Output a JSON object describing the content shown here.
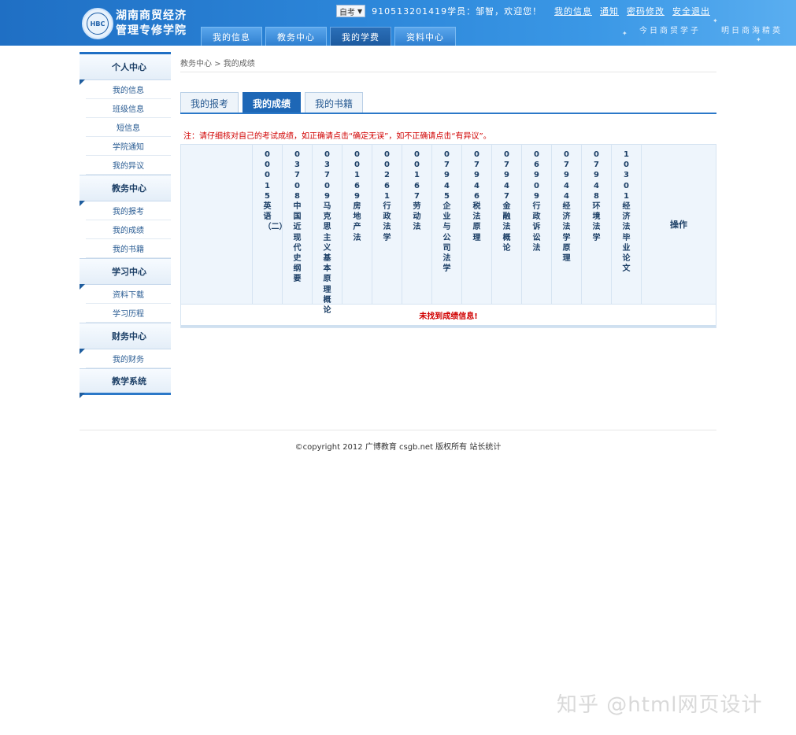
{
  "header": {
    "school_name_line1": "湖南商贸经济",
    "school_name_line2": "管理专修学院",
    "logo_text": "HBC",
    "exam_type": "自考",
    "welcome": "910513201419学员：邹智，欢迎您！",
    "links": [
      "我的信息",
      "通知",
      "密码修改",
      "安全退出"
    ],
    "slogan": "今日商贸学子　　明日商海精英",
    "nav_tabs": [
      "我的信息",
      "教务中心",
      "我的学费",
      "资料中心"
    ],
    "active_nav": "我的学费"
  },
  "sidebar": {
    "sections": [
      {
        "title": "个人中心",
        "items": [
          "我的信息",
          "班级信息",
          "短信息",
          "学院通知",
          "我的异议"
        ]
      },
      {
        "title": "教务中心",
        "items": [
          "我的报考",
          "我的成绩",
          "我的书籍"
        ]
      },
      {
        "title": "学习中心",
        "items": [
          "资料下载",
          "学习历程"
        ]
      },
      {
        "title": "财务中心",
        "items": [
          "我的财务"
        ]
      },
      {
        "title": "教学系统",
        "items": []
      }
    ]
  },
  "breadcrumb": "教务中心 > 我的成绩",
  "tabs": [
    "我的报考",
    "我的成绩",
    "我的书籍"
  ],
  "active_tab": "我的成绩",
  "note": "注：请仔细核对自己的考试成绩，如正确请点击“确定无误”，如不正确请点击“有异议”。",
  "table": {
    "columns": [
      "00015英语（二）",
      "03708中国近现代史纲要",
      "03709马克思主义基本原理概论",
      "00169房地产法",
      "00261行政法学",
      "00167劳动法",
      "07945企业与公司法学",
      "07946税法原理",
      "07947金融法概论",
      "06909行政诉讼法",
      "07944经济法学原理",
      "07948环境法学",
      "10301经济法毕业论文"
    ],
    "operation_label": "操作",
    "empty_message": "未找到成绩信息!"
  },
  "footer": "©copyright 2012 广博教育 csgb.net 版权所有 站长统计",
  "watermark": "知乎 @html网页设计"
}
